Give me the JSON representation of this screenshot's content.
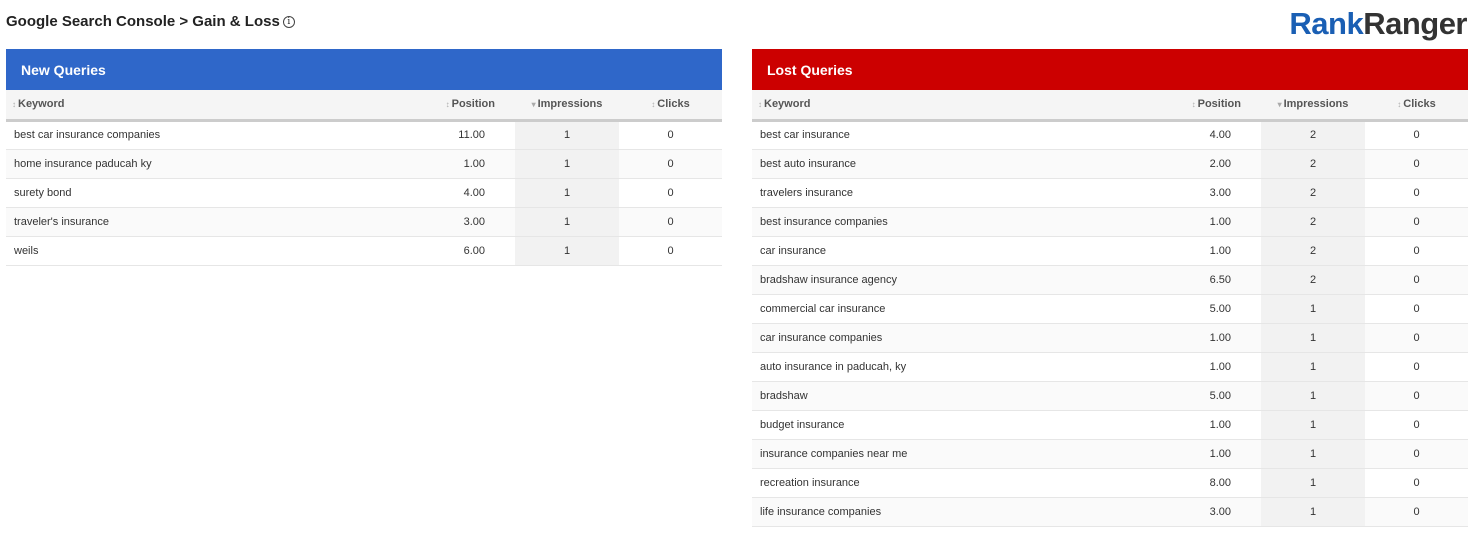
{
  "header": {
    "title": "Google Search Console > Gain & Loss",
    "info_icon": "info-icon",
    "logo_part1": "Rank",
    "logo_part2": "Ranger"
  },
  "columns": {
    "keyword": "Keyword",
    "position": "Position",
    "impressions": "Impressions",
    "clicks": "Clicks"
  },
  "new_queries": {
    "title": "New Queries",
    "color": "#2f67c9",
    "rows": [
      {
        "keyword": "best car insurance companies",
        "position": "11.00",
        "impressions": "1",
        "clicks": "0"
      },
      {
        "keyword": "home insurance paducah ky",
        "position": "1.00",
        "impressions": "1",
        "clicks": "0"
      },
      {
        "keyword": "surety bond",
        "position": "4.00",
        "impressions": "1",
        "clicks": "0"
      },
      {
        "keyword": "traveler's insurance",
        "position": "3.00",
        "impressions": "1",
        "clicks": "0"
      },
      {
        "keyword": "weils",
        "position": "6.00",
        "impressions": "1",
        "clicks": "0"
      }
    ]
  },
  "lost_queries": {
    "title": "Lost Queries",
    "color": "#cc0000",
    "rows": [
      {
        "keyword": "best car insurance",
        "position": "4.00",
        "impressions": "2",
        "clicks": "0"
      },
      {
        "keyword": "best auto insurance",
        "position": "2.00",
        "impressions": "2",
        "clicks": "0"
      },
      {
        "keyword": "travelers insurance",
        "position": "3.00",
        "impressions": "2",
        "clicks": "0"
      },
      {
        "keyword": "best insurance companies",
        "position": "1.00",
        "impressions": "2",
        "clicks": "0"
      },
      {
        "keyword": "car insurance",
        "position": "1.00",
        "impressions": "2",
        "clicks": "0"
      },
      {
        "keyword": "bradshaw insurance agency",
        "position": "6.50",
        "impressions": "2",
        "clicks": "0"
      },
      {
        "keyword": "commercial car insurance",
        "position": "5.00",
        "impressions": "1",
        "clicks": "0"
      },
      {
        "keyword": "car insurance companies",
        "position": "1.00",
        "impressions": "1",
        "clicks": "0"
      },
      {
        "keyword": "auto insurance in paducah, ky",
        "position": "1.00",
        "impressions": "1",
        "clicks": "0"
      },
      {
        "keyword": "bradshaw",
        "position": "5.00",
        "impressions": "1",
        "clicks": "0"
      },
      {
        "keyword": "budget insurance",
        "position": "1.00",
        "impressions": "1",
        "clicks": "0"
      },
      {
        "keyword": "insurance companies near me",
        "position": "1.00",
        "impressions": "1",
        "clicks": "0"
      },
      {
        "keyword": "recreation insurance",
        "position": "8.00",
        "impressions": "1",
        "clicks": "0"
      },
      {
        "keyword": "life insurance companies",
        "position": "3.00",
        "impressions": "1",
        "clicks": "0"
      }
    ]
  }
}
